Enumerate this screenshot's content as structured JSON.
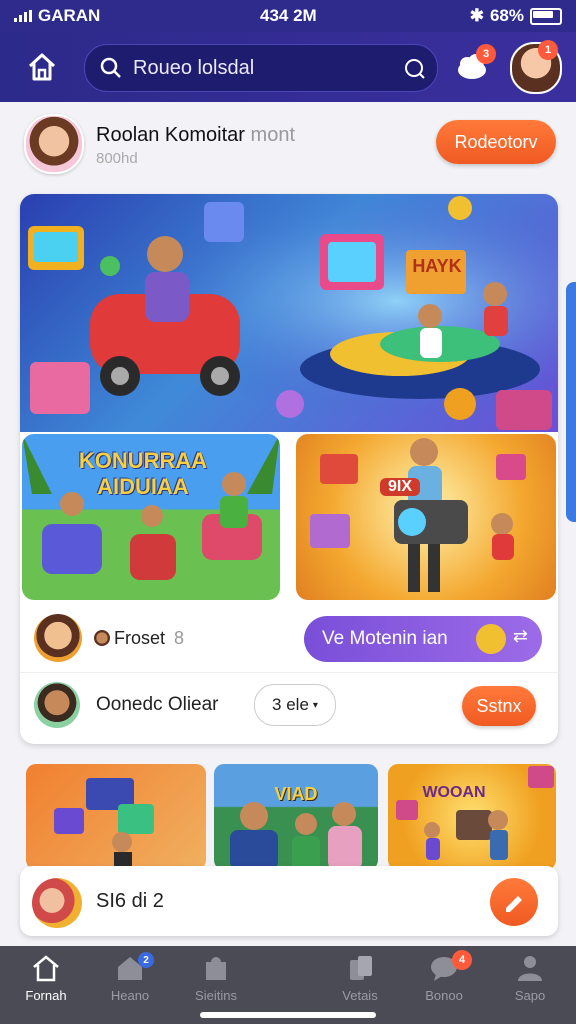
{
  "status_bar": {
    "carrier": "GARAN",
    "time": "434 2M",
    "battery": "68%"
  },
  "header": {
    "search_text": "Roueo lolsdal",
    "notification_count": "3",
    "profile_badge": "1"
  },
  "profile_row": {
    "name": "Roolan Komoitar",
    "name_faded": "mont",
    "subtitle": "800hd",
    "button": "Rodeotorv"
  },
  "feature_card": {
    "hero_sign": "HAYK",
    "thumb_left_title": "KONURRAA AIDUIAA",
    "thumb_right_sign": "9IX",
    "row_a": {
      "label": "Froset",
      "count": "8",
      "button": "Ve Motenin ian"
    },
    "row_b": {
      "label": "Oonedc Oliear",
      "select": "3 ele",
      "button": "Sstnx"
    }
  },
  "strip": {
    "left_sign": "VIAD",
    "right_sign": "WOOAN"
  },
  "bottom_card": {
    "label": "SI6 di 2"
  },
  "tabbar": {
    "tabs": [
      {
        "label": "Fornah",
        "icon": "home-icon"
      },
      {
        "label": "Heano",
        "icon": "house-icon",
        "badge": "2"
      },
      {
        "label": "Sieitins",
        "icon": "puzzle-icon"
      },
      {
        "label": "Vetais",
        "icon": "cards-icon"
      },
      {
        "label": "Bonoo",
        "icon": "chat-icon",
        "badge": "4"
      },
      {
        "label": "Sapo",
        "icon": "person-icon"
      }
    ]
  },
  "colors": {
    "brand": "#2e2b8c",
    "accent": "#f05a22",
    "purple": "#8a5ae0"
  }
}
